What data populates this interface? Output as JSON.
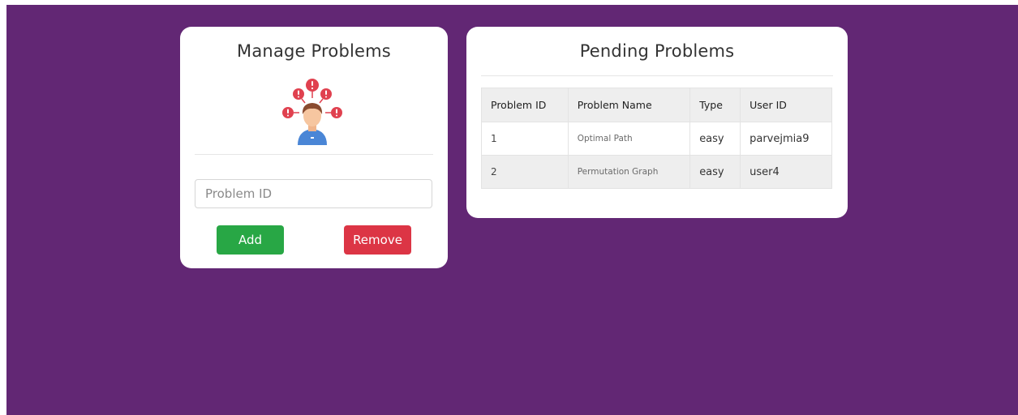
{
  "manage": {
    "title": "Manage Problems",
    "illustration_icon": "user-with-alerts-icon",
    "input_placeholder": "Problem ID",
    "add_label": "Add",
    "remove_label": "Remove",
    "add_color": "#28a745",
    "remove_color": "#dc3545"
  },
  "pending": {
    "title": "Pending Problems",
    "columns": [
      "Problem ID",
      "Problem Name",
      "Type",
      "User ID"
    ],
    "rows": [
      {
        "id": "1",
        "name": "Optimal Path",
        "type": "easy",
        "user": "parvejmia9"
      },
      {
        "id": "2",
        "name": "Permutation Graph",
        "type": "easy",
        "user": "user4"
      }
    ]
  },
  "colors": {
    "background": "#622774",
    "card": "#ffffff"
  }
}
